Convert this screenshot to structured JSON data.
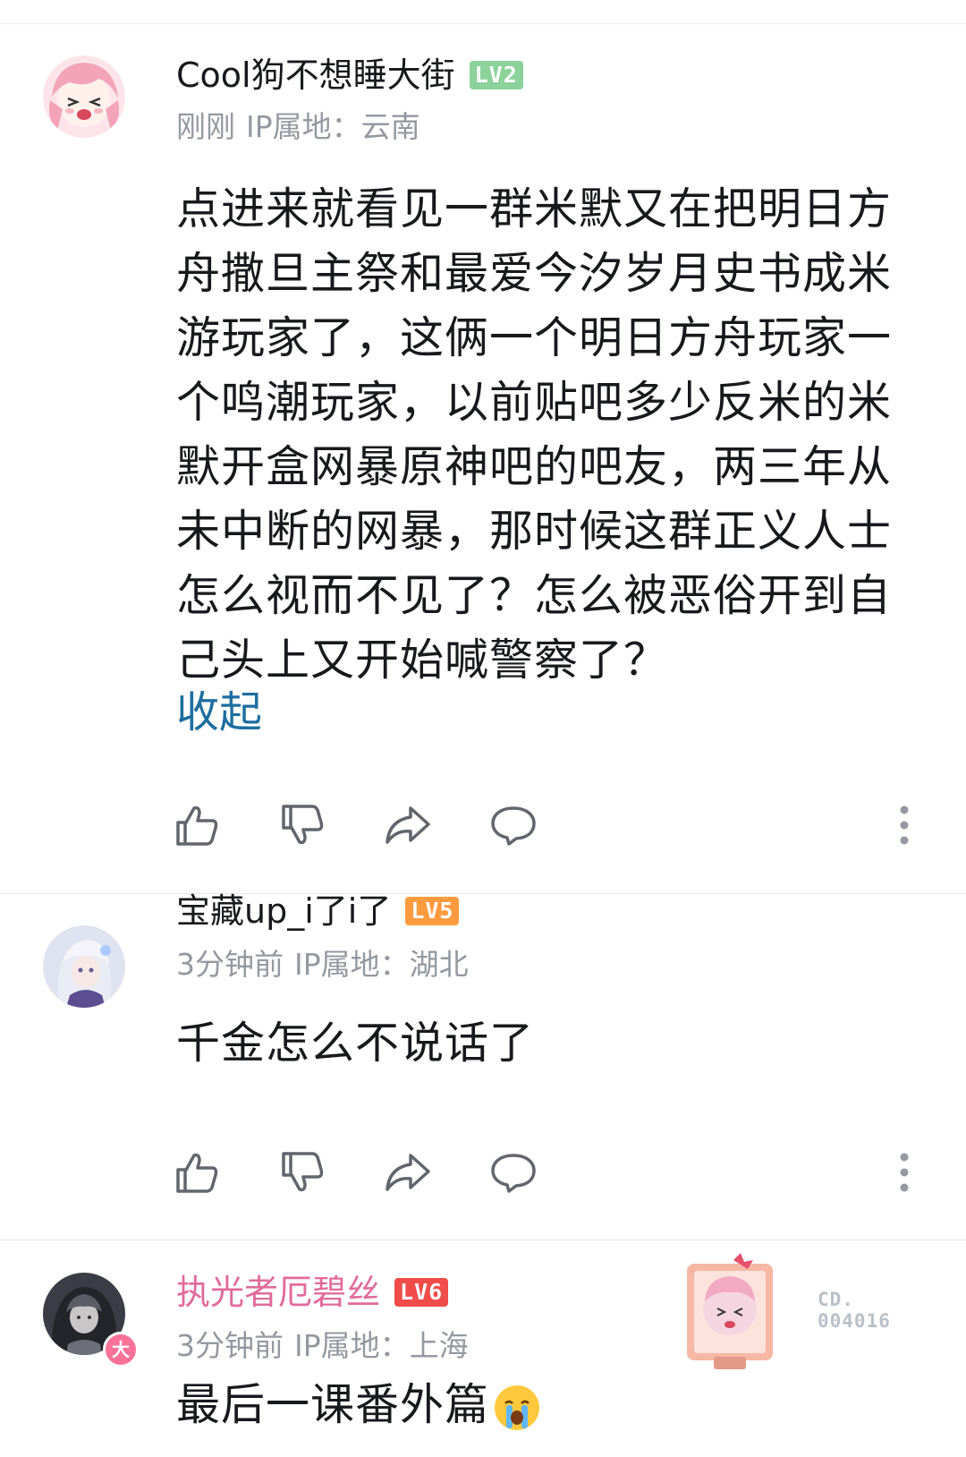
{
  "comments": [
    {
      "username": "Cool狗不想睡大街",
      "level": "LV2",
      "level_color": "#8bd29b",
      "time": "刚刚",
      "ip": "IP属地：云南",
      "text": "点进来就看见一群米默又在把明日方舟撒旦主祭和最爱今汐岁月史书成米游玩家了，这俩一个明日方舟玩家一个鸣潮玩家，以前贴吧多少反米的米默开盒网暴原神吧的吧友，两三年从未中断的网暴，那时候这群正义人士怎么视而不见了？怎么被恶俗开到自己头上又开始喊警察了？",
      "collapse_label": "收起"
    },
    {
      "username": "宝藏up_i了i了",
      "level": "LV5",
      "level_color": "#ff9b3f",
      "time": "3分钟前",
      "ip": "IP属地：湖北",
      "text": "千金怎么不说话了"
    },
    {
      "username": "执光者厄碧丝",
      "username_color": "#e16b9c",
      "level": "LV6",
      "level_color": "#f04c49",
      "vip_mark": "大",
      "time": "3分钟前",
      "ip": "IP属地：上海",
      "text": "最后一课番外篇",
      "text_emoji": "crying-face-emoji",
      "decoration_serial": "CD.\n004016"
    }
  ],
  "icons": {
    "like": "thumbs-up-icon",
    "dislike": "thumbs-down-icon",
    "share": "share-icon",
    "reply": "comment-bubble-icon",
    "more": "more-vertical-icon"
  }
}
